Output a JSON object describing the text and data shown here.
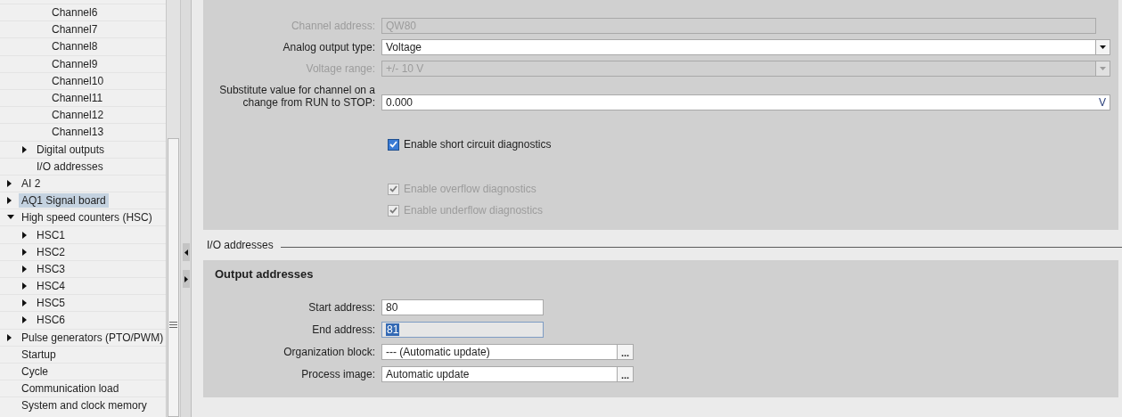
{
  "tree": [
    {
      "children": [
        {
          "children": [
            {
              "label": "Channel6",
              "selected": false
            },
            {
              "label": "Channel7",
              "selected": false
            },
            {
              "label": "Channel8",
              "selected": false
            },
            {
              "label": "Channel9",
              "selected": false
            },
            {
              "label": "Channel10",
              "selected": false
            },
            {
              "label": "Channel11",
              "selected": false
            },
            {
              "label": "Channel12",
              "selected": false
            },
            {
              "label": "Channel13",
              "selected": false
            }
          ]
        },
        {
          "label": "Digital outputs",
          "expanded": false,
          "selected": false
        },
        {
          "label": "I/O addresses",
          "selected": false
        }
      ]
    },
    {
      "label": "AI 2",
      "expanded": false,
      "selected": false
    },
    {
      "label": "AQ1 Signal board",
      "expanded": false,
      "selected": true
    },
    {
      "label": "High speed counters (HSC)",
      "expanded": true,
      "selected": false,
      "children": [
        {
          "label": "HSC1",
          "expanded": false,
          "selected": false
        },
        {
          "label": "HSC2",
          "expanded": false,
          "selected": false
        },
        {
          "label": "HSC3",
          "expanded": false,
          "selected": false
        },
        {
          "label": "HSC4",
          "expanded": false,
          "selected": false
        },
        {
          "label": "HSC5",
          "expanded": false,
          "selected": false
        },
        {
          "label": "HSC6",
          "expanded": false,
          "selected": false
        }
      ]
    },
    {
      "label": "Pulse generators (PTO/PWM)",
      "expanded": false,
      "selected": false
    },
    {
      "label": "Startup",
      "selected": false
    },
    {
      "label": "Cycle",
      "selected": false
    },
    {
      "label": "Communication load",
      "selected": false
    },
    {
      "label": "System and clock memory",
      "selected": false
    }
  ],
  "channel_settings": {
    "fields": [
      {
        "kind": "text",
        "label": "Channel address:",
        "value": "QW80",
        "disabled": true
      },
      {
        "kind": "dropdown",
        "label": "Analog output type:",
        "value": "Voltage",
        "disabled": false
      },
      {
        "kind": "dropdown",
        "label": "Voltage range:",
        "value": "+/- 10 V",
        "disabled": true
      },
      {
        "kind": "unit",
        "label": "Substitute value for channel on a change from RUN to STOP:",
        "value": "0.000",
        "unit": "V",
        "disabled": false
      }
    ],
    "checkboxes": [
      {
        "label": "Enable short circuit diagnostics",
        "checked": true,
        "disabled": false
      },
      {
        "label": "Enable overflow diagnostics",
        "checked": true,
        "disabled": true
      },
      {
        "label": "Enable underflow diagnostics",
        "checked": true,
        "disabled": true
      }
    ]
  },
  "io_addresses": {
    "title": "I/O addresses",
    "group_title": "Output addresses",
    "fields": [
      {
        "kind": "text",
        "label": "Start address:",
        "value": "80",
        "readonly": false,
        "text_selected": false
      },
      {
        "kind": "text",
        "label": "End address:",
        "value": "81",
        "readonly": true,
        "text_selected": true
      },
      {
        "kind": "browse",
        "label": "Organization block:",
        "value": "--- (Automatic update)",
        "button_label": "..."
      },
      {
        "kind": "browse",
        "label": "Process image:",
        "value": "Automatic update",
        "button_label": "..."
      }
    ]
  }
}
